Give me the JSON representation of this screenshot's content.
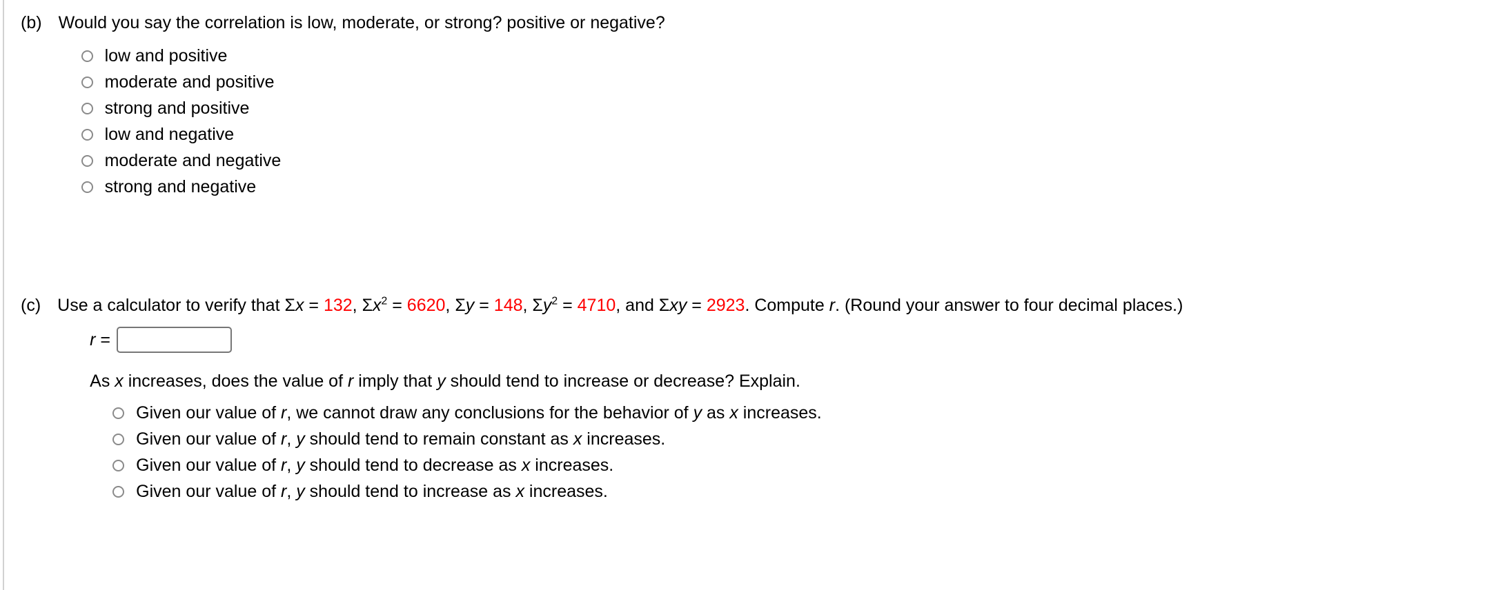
{
  "part_b": {
    "label": "(b)",
    "prompt": "Would you say the correlation is low, moderate, or strong? positive or negative?",
    "options": [
      "low and positive",
      "moderate and positive",
      "strong and positive",
      "low and negative",
      "moderate and negative",
      "strong and negative"
    ]
  },
  "part_c": {
    "label": "(c)",
    "prompt_lead": "Use a calculator to verify that ",
    "stats": [
      {
        "symbol_sigma": "Σ",
        "symbol_var": "x",
        "exponent": "",
        "sep": " = ",
        "value": "132",
        "trail": ", "
      },
      {
        "symbol_sigma": "Σ",
        "symbol_var": "x",
        "exponent": "2",
        "sep": " = ",
        "value": "6620",
        "trail": ", "
      },
      {
        "symbol_sigma": "Σ",
        "symbol_var": "y",
        "exponent": "",
        "sep": " = ",
        "value": "148",
        "trail": ", "
      },
      {
        "symbol_sigma": "Σ",
        "symbol_var": "y",
        "exponent": "2",
        "sep": " = ",
        "value": "4710",
        "trail": ", and "
      },
      {
        "symbol_sigma": "Σ",
        "symbol_var": "xy",
        "exponent": "",
        "sep": " = ",
        "value": "2923",
        "trail": ". "
      }
    ],
    "prompt_tail_a": "Compute ",
    "prompt_tail_var": "r",
    "prompt_tail_b": ". (Round your answer to four decimal places.)",
    "answer_label_var": "r",
    "answer_label_eq": " = ",
    "answer_value": "",
    "answer_placeholder": "",
    "subprompt": {
      "s1": "As ",
      "v1": "x",
      "s2": " increases, does the value of ",
      "v2": "r",
      "s3": " imply that ",
      "v3": "y",
      "s4": " should tend to increase or decrease? Explain."
    },
    "options": [
      {
        "s1": "Given our value of ",
        "v1": "r",
        "s2": ", we cannot draw any conclusions for the behavior of ",
        "v2": "y",
        "s3": " as ",
        "v3": "x",
        "s4": " increases."
      },
      {
        "s1": "Given our value of ",
        "v1": "r",
        "s2": ", ",
        "v2": "y",
        "s3": " should tend to remain constant as ",
        "v3": "x",
        "s4": " increases."
      },
      {
        "s1": "Given our value of ",
        "v1": "r",
        "s2": ", ",
        "v2": "y",
        "s3": " should tend to decrease as ",
        "v3": "x",
        "s4": " increases."
      },
      {
        "s1": "Given our value of ",
        "v1": "r",
        "s2": ", ",
        "v2": "y",
        "s3": " should tend to increase as ",
        "v3": "x",
        "s4": " increases."
      }
    ]
  },
  "colors": {
    "value_red": "#ff0000",
    "text_black": "#000000",
    "radio_border": "#8a8a8a",
    "input_border": "#767676",
    "page_edge": "#d2d2d2"
  }
}
